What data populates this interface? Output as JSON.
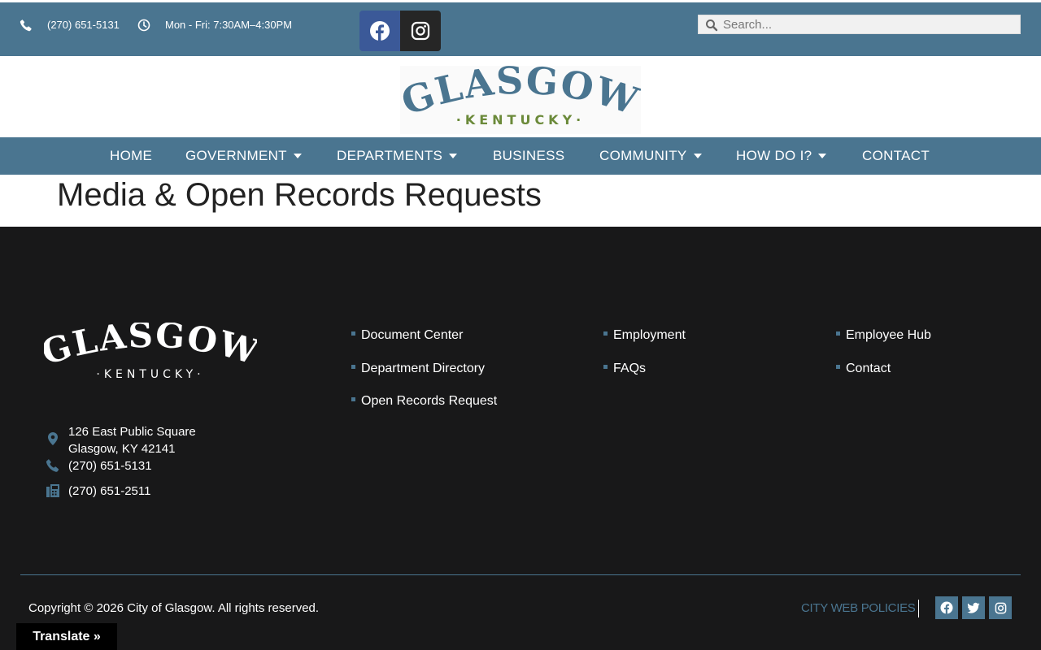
{
  "topbar": {
    "phone": "(270) 651-5131",
    "hours": "Mon - Fri: 7:30AM–4:30PM",
    "search_placeholder": "Search..."
  },
  "logo": {
    "title": "GLASGOW",
    "subtitle": "·KENTUCKY·"
  },
  "nav": {
    "items": [
      {
        "label": "HOME"
      },
      {
        "label": "GOVERNMENT"
      },
      {
        "label": "DEPARTMENTS"
      },
      {
        "label": "BUSINESS"
      },
      {
        "label": "COMMUNITY"
      },
      {
        "label": "HOW DO I?"
      },
      {
        "label": "CONTACT"
      }
    ]
  },
  "page": {
    "title": "Media & Open Records Requests"
  },
  "footer": {
    "logo_title": "GLASGOW",
    "logo_subtitle": "·KENTUCKY·",
    "address_line1": "126 East Public Square",
    "address_line2": "Glasgow, KY 42141",
    "phone": "(270) 651-5131",
    "fax": "(270) 651-2511",
    "links_col1": [
      "Document Center",
      "Department Directory",
      "Open Records Request"
    ],
    "links_col2": [
      "Employment",
      "FAQs"
    ],
    "links_col3": [
      "Employee Hub",
      "Contact"
    ],
    "copyright": "Copyright © 2026 City of Glasgow. All rights reserved.",
    "policies": "CITY WEB POLICIES"
  },
  "translate": {
    "label": "Translate »"
  },
  "colors": {
    "brand_blue": "#4a7590",
    "footer_bg": "#181819",
    "kentucky_green": "#6b8a3a"
  }
}
